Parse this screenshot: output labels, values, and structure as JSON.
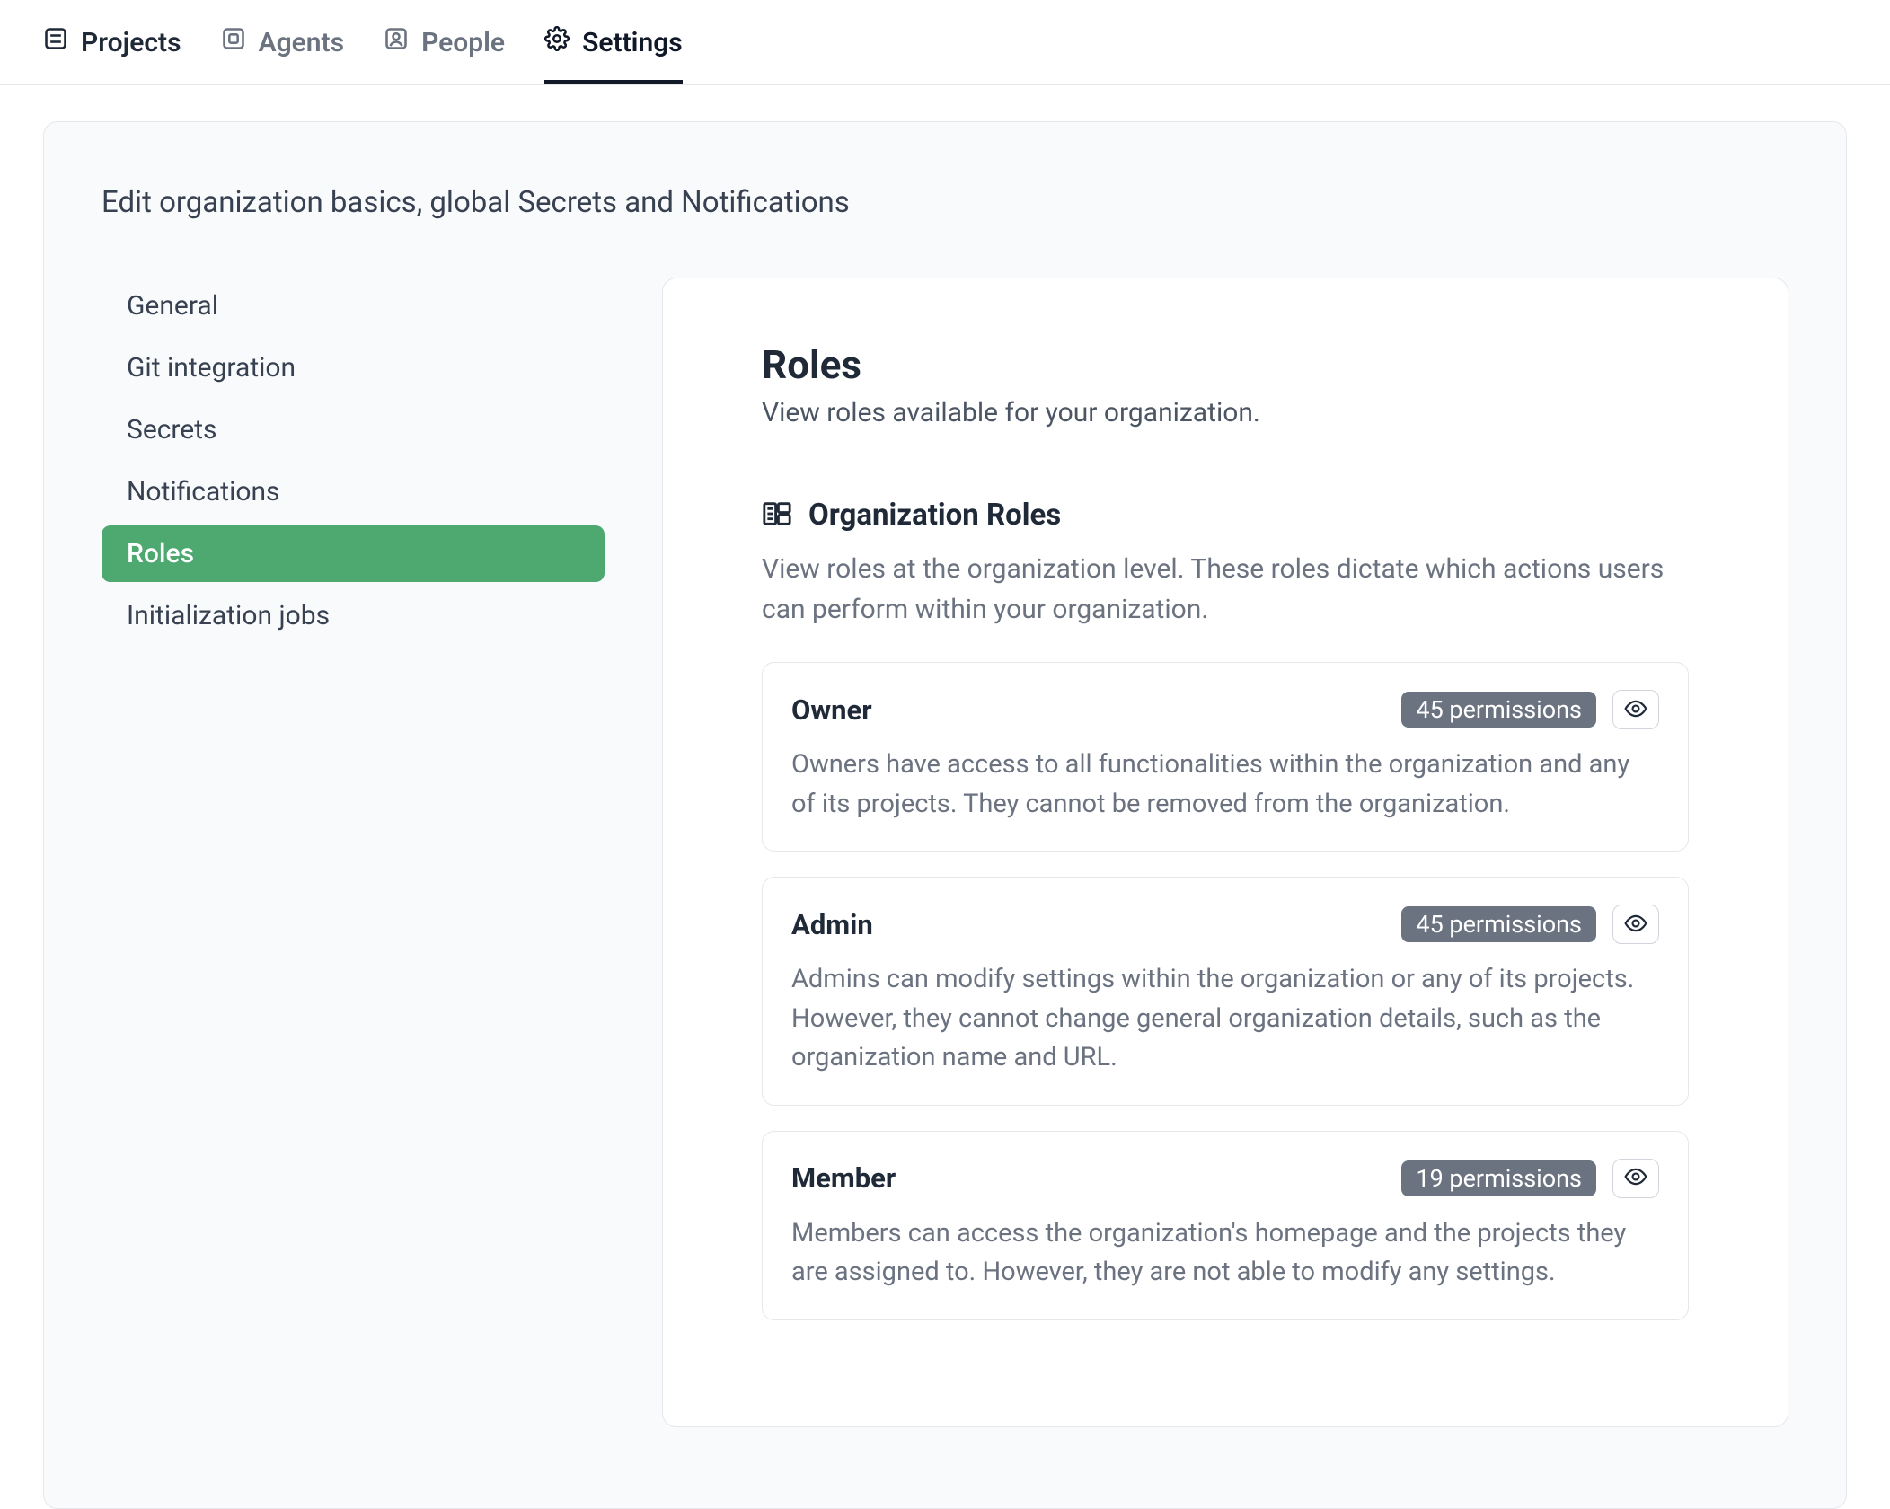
{
  "topnav": {
    "items": [
      {
        "label": "Projects",
        "icon": "projects-icon"
      },
      {
        "label": "Agents",
        "icon": "agents-icon"
      },
      {
        "label": "People",
        "icon": "people-icon"
      },
      {
        "label": "Settings",
        "icon": "settings-icon"
      }
    ],
    "active_index": 3
  },
  "container": {
    "subtitle": "Edit organization basics, global Secrets and Notifications"
  },
  "sidebar": {
    "items": [
      {
        "label": "General"
      },
      {
        "label": "Git integration"
      },
      {
        "label": "Secrets"
      },
      {
        "label": "Notifications"
      },
      {
        "label": "Roles"
      },
      {
        "label": "Initialization jobs"
      }
    ],
    "active_index": 4
  },
  "panel": {
    "title": "Roles",
    "description": "View roles available for your organization."
  },
  "section": {
    "title": "Organization Roles",
    "description": "View roles at the organization level. These roles dictate which actions users can perform within your organization."
  },
  "roles": [
    {
      "name": "Owner",
      "permissions_label": "45 permissions",
      "description": "Owners have access to all functionalities within the organization and any of its projects. They cannot be removed from the organization."
    },
    {
      "name": "Admin",
      "permissions_label": "45 permissions",
      "description": "Admins can modify settings within the organization or any of its projects. However, they cannot change general organization details, such as the organization name and URL."
    },
    {
      "name": "Member",
      "permissions_label": "19 permissions",
      "description": "Members can access the organization's homepage and the projects they are assigned to. However, they are not able to modify any settings."
    }
  ]
}
